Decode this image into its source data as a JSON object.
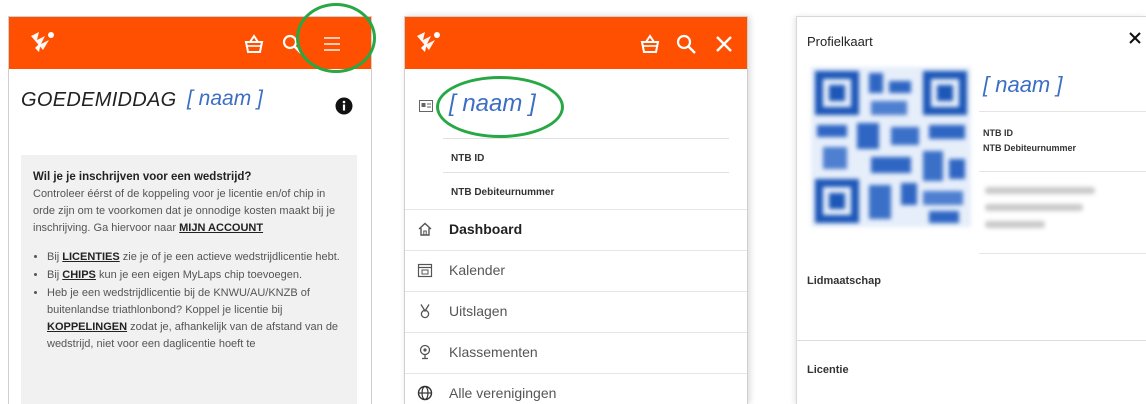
{
  "panel_home": {
    "greeting": "GOEDEMIDDAG",
    "name_placeholder": "[ naam ]",
    "question": "Wil je je inschrijven voor een wedstrijd?",
    "intro_text": "Controleer éérst of de koppeling voor je licentie en/of chip in orde zijn om te voorkomen dat je onnodige kosten maakt bij je inschrijving. Ga hiervoor naar ",
    "intro_link": "MIJN ACCOUNT",
    "bullets": [
      {
        "pre": "Bij ",
        "link": "LICENTIES",
        "post": " zie je of je een actieve wedstrijdlicentie hebt."
      },
      {
        "pre": "Bij ",
        "link": "CHIPS",
        "post": " kun je een eigen MyLaps chip toevoegen."
      },
      {
        "pre": "Heb je een wedstrijdlicentie bij de KNWU/AU/KNZB of buitenlandse triathlonbond? Koppel je licentie bij ",
        "link": "KOPPELINGEN",
        "post": " zodat je, afhankelijk van de afstand van de wedstrijd, niet voor een daglicentie hoeft te"
      }
    ]
  },
  "panel_menu": {
    "name_placeholder": "[ naam ]",
    "ntb_id_label": "NTB ID",
    "ntb_debtor_label": "NTB Debiteurnummer",
    "items": [
      {
        "label": "Dashboard",
        "icon": "home-icon",
        "active": true
      },
      {
        "label": "Kalender",
        "icon": "calendar-icon",
        "active": false
      },
      {
        "label": "Uitslagen",
        "icon": "medal-icon",
        "active": false
      },
      {
        "label": "Klassementen",
        "icon": "trophy-icon",
        "active": false
      },
      {
        "label": "Alle verenigingen",
        "icon": "globe-icon",
        "active": false
      }
    ]
  },
  "panel_profile": {
    "title": "Profielkaart",
    "name_placeholder": "[ naam ]",
    "ntb_id_label": "NTB ID",
    "ntb_debtor_label": "NTB Debiteurnummer",
    "section_membership": "Lidmaatschap",
    "section_license": "Licentie",
    "close_symbol": "✕"
  },
  "colors": {
    "brand_orange": "#fe5000",
    "name_blue": "#3c6fc4",
    "highlight_green": "#27a844"
  }
}
